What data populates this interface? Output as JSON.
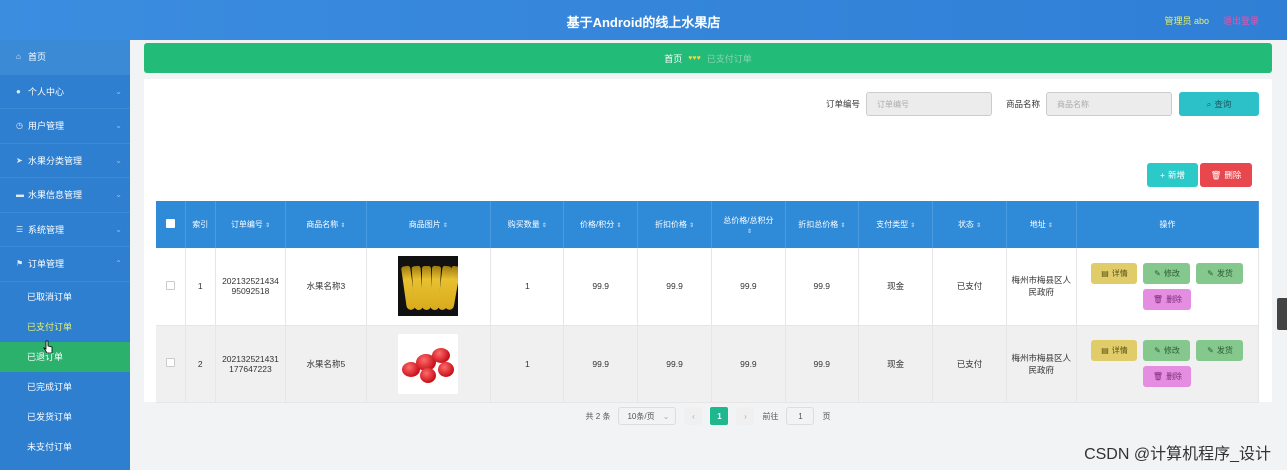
{
  "header": {
    "title": "基于Android的线上水果店",
    "admin_label": "管理员 abo",
    "logout_label": "退出登录"
  },
  "sidebar": {
    "items": [
      {
        "label": "首页",
        "icon": "home-icon"
      },
      {
        "label": "个人中心",
        "icon": "user-icon"
      },
      {
        "label": "用户管理",
        "icon": "clock-icon"
      },
      {
        "label": "水果分类管理",
        "icon": "send-icon"
      },
      {
        "label": "水果信息管理",
        "icon": "chat-icon"
      },
      {
        "label": "系统管理",
        "icon": "list-icon"
      },
      {
        "label": "订单管理",
        "icon": "flag-icon"
      }
    ],
    "order_sub": [
      "已取消订单",
      "已支付订单",
      "已退款订单",
      "已完成订单",
      "已发货订单",
      "未支付订单"
    ],
    "sub_active_visible": "已退",
    "sub_active_tail": "订单"
  },
  "breadcrumb": {
    "home": "首页",
    "hearts": "♥♥♥",
    "current": "已支付订单"
  },
  "search": {
    "order_no_label": "订单编号",
    "order_no_placeholder": "订单编号",
    "product_label": "商品名称",
    "product_placeholder": "商品名称",
    "search_button": "查询"
  },
  "actions": {
    "add": "新增",
    "delete": "删除"
  },
  "table": {
    "headers": [
      "索引",
      "订单编号",
      "商品名称",
      "商品图片",
      "购买数量",
      "价格/积分",
      "折扣价格",
      "总价格/总积分",
      "折扣总价格",
      "支付类型",
      "状态",
      "地址",
      "操作"
    ],
    "rows": [
      {
        "index": "1",
        "order_no": "202132521434 95092518",
        "product": "水果名称3",
        "image": "banana",
        "qty": "1",
        "price": "99.9",
        "discount": "99.9",
        "total": "99.9",
        "discount_total": "99.9",
        "pay_type": "现金",
        "status": "已支付",
        "address": "梅州市梅县区人民政府"
      },
      {
        "index": "2",
        "order_no": "202132521431 177647223",
        "product": "水果名称5",
        "image": "wax-apple",
        "qty": "1",
        "price": "99.9",
        "discount": "99.9",
        "total": "99.9",
        "discount_total": "99.9",
        "pay_type": "现金",
        "status": "已支付",
        "address": "梅州市梅县区人民政府"
      }
    ],
    "row_ops": {
      "detail": "详情",
      "edit": "修改",
      "ship": "发货",
      "remove": "删除"
    }
  },
  "pagination": {
    "total": "共 2 条",
    "page_size": "10条/页",
    "current_page": "1",
    "goto_prefix": "前往",
    "goto_value": "1",
    "goto_suffix": "页"
  },
  "watermark": "CSDN @计算机程序_设计"
}
